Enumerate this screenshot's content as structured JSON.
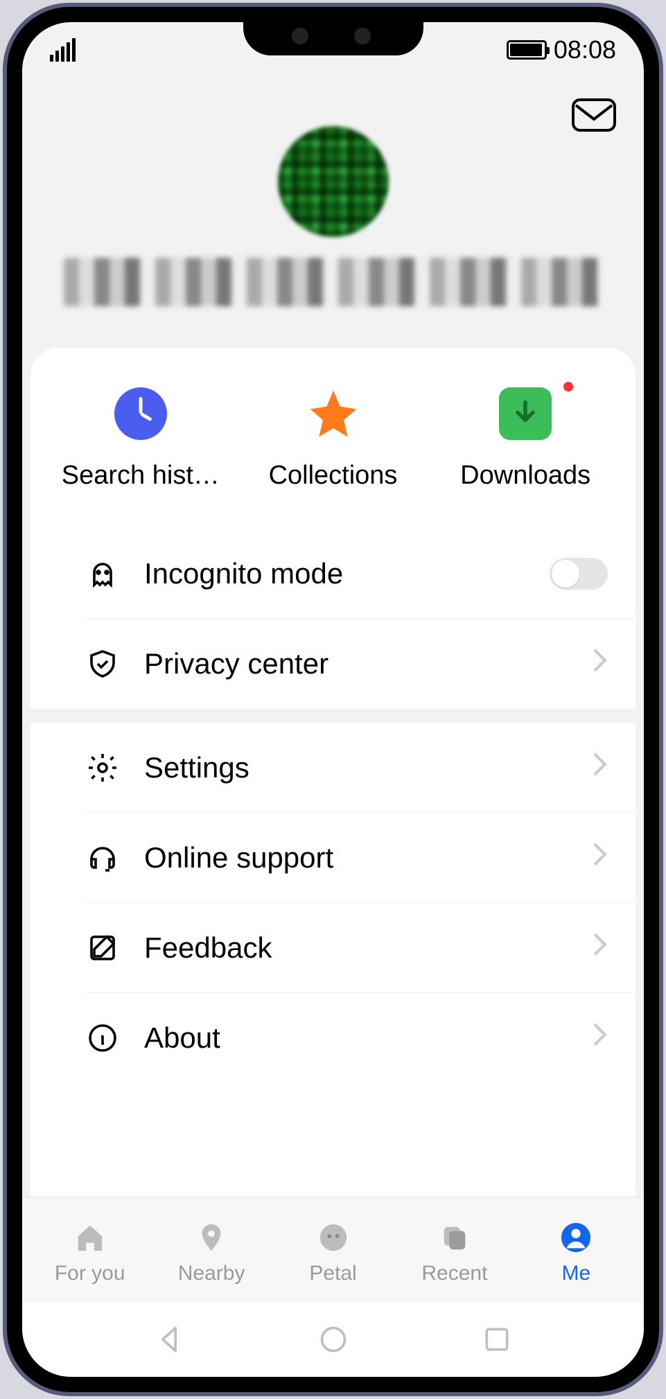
{
  "status": {
    "time": "08:08"
  },
  "quick": [
    {
      "label": "Search hist…",
      "name": "search-history"
    },
    {
      "label": "Collections",
      "name": "collections"
    },
    {
      "label": "Downloads",
      "name": "downloads",
      "badge": true
    }
  ],
  "rows_a": [
    {
      "label": "Incognito mode",
      "control": "toggle",
      "state": "off",
      "icon": "ghost"
    },
    {
      "label": "Privacy center",
      "control": "chevron",
      "icon": "shield"
    }
  ],
  "rows_b": [
    {
      "label": "Settings",
      "control": "chevron",
      "icon": "gear"
    },
    {
      "label": "Online support",
      "control": "chevron",
      "icon": "headset"
    },
    {
      "label": "Feedback",
      "control": "chevron",
      "icon": "compose"
    },
    {
      "label": "About",
      "control": "chevron",
      "icon": "info"
    }
  ],
  "tabs": [
    {
      "label": "For you",
      "icon": "home",
      "active": false
    },
    {
      "label": "Nearby",
      "icon": "pin",
      "active": false
    },
    {
      "label": "Petal",
      "icon": "face",
      "active": false
    },
    {
      "label": "Recent",
      "icon": "stack",
      "active": false
    },
    {
      "label": "Me",
      "icon": "person",
      "active": true
    }
  ]
}
